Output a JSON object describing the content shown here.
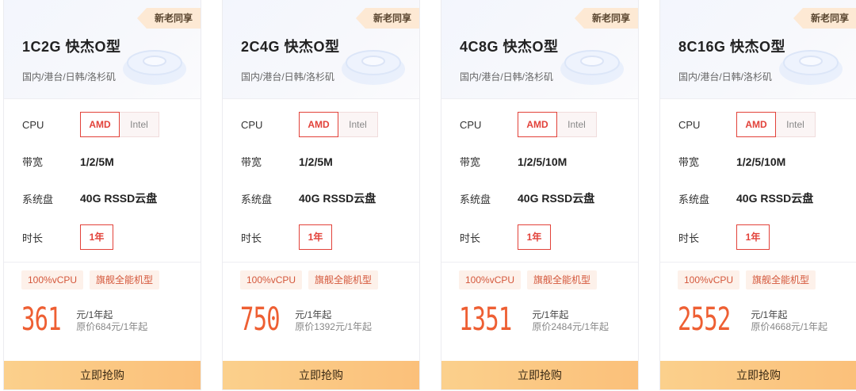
{
  "labels": {
    "cpu": "CPU",
    "bandwidth": "带宽",
    "disk": "系统盘",
    "duration": "时长",
    "unit": "元/1年起",
    "buy": "立即抢购"
  },
  "cards": [
    {
      "tag": "新老同享",
      "title": "1C2G 快杰O型",
      "regions": "国内/港台/日韩/洛杉矶",
      "cpu_options": [
        "AMD",
        "Intel"
      ],
      "bandwidth": "1/2/5M",
      "disk": "40G RSSD云盘",
      "duration": "1年",
      "features": [
        "100%vCPU",
        "旗舰全能机型"
      ],
      "price": "361",
      "unit": "元/1年起",
      "original": "原价684元/1年起",
      "buy": "立即抢购"
    },
    {
      "tag": "新老同享",
      "title": "2C4G 快杰O型",
      "regions": "国内/港台/日韩/洛杉矶",
      "cpu_options": [
        "AMD",
        "Intel"
      ],
      "bandwidth": "1/2/5M",
      "disk": "40G RSSD云盘",
      "duration": "1年",
      "features": [
        "100%vCPU",
        "旗舰全能机型"
      ],
      "price": "750",
      "unit": "元/1年起",
      "original": "原价1392元/1年起",
      "buy": "立即抢购"
    },
    {
      "tag": "新老同享",
      "title": "4C8G 快杰O型",
      "regions": "国内/港台/日韩/洛杉矶",
      "cpu_options": [
        "AMD",
        "Intel"
      ],
      "bandwidth": "1/2/5/10M",
      "disk": "40G RSSD云盘",
      "duration": "1年",
      "features": [
        "100%vCPU",
        "旗舰全能机型"
      ],
      "price": "1351",
      "unit": "元/1年起",
      "original": "原价2484元/1年起",
      "buy": "立即抢购"
    },
    {
      "tag": "新老同享",
      "title": "8C16G 快杰O型",
      "regions": "国内/港台/日韩/洛杉矶",
      "cpu_options": [
        "AMD",
        "Intel"
      ],
      "bandwidth": "1/2/5/10M",
      "disk": "40G RSSD云盘",
      "duration": "1年",
      "features": [
        "100%vCPU",
        "旗舰全能机型"
      ],
      "price": "2552",
      "unit": "元/1年起",
      "original": "原价4668元/1年起",
      "buy": "立即抢购"
    }
  ],
  "colors": {
    "accent": "#ee5f33",
    "selected_border": "#e2423a",
    "tag_bg": "#fde9d4",
    "button_bg": "#fbc07a"
  }
}
